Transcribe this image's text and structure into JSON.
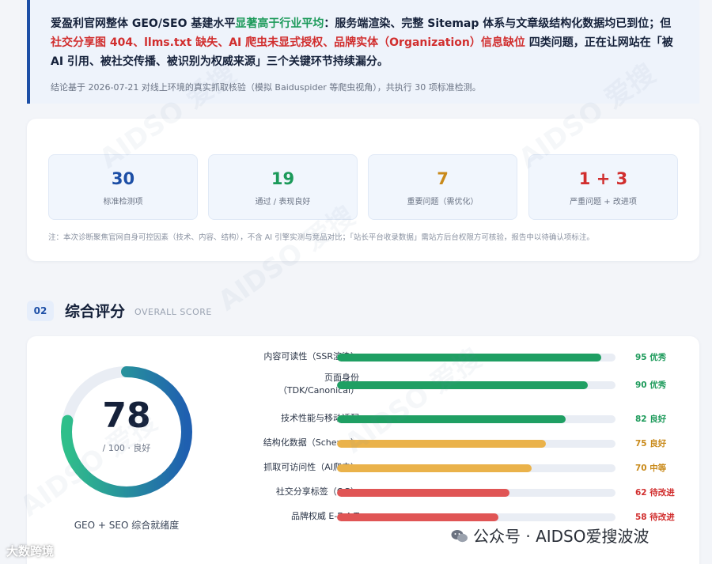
{
  "summary": {
    "part1": "爱盈利官网整体 GEO/SEO 基建水平",
    "highlight_green": "显著高于行业平均",
    "part2": "：服务端渲染、完整 Sitemap 体系与文章级结构化数据均已到位；但 ",
    "highlight_red": "社交分享图 404、llms.txt 缺失、AI 爬虫未显式授权、品牌实体（Organization）信息缺位",
    "part3": " 四类问题，正在让网站在「被 AI 引用、被社交传播、被识别为权威来源」三个关键环节持续漏分。",
    "note": "结论基于 2026-07-21 对线上环境的真实抓取核验（模拟 Baiduspider 等爬虫视角），共执行 30 项标准检测。"
  },
  "stats": [
    {
      "value": "30",
      "label": "标准检测项",
      "color": "#1d4fa6"
    },
    {
      "value": "19",
      "label": "通过 / 表现良好",
      "color": "#1c9a5a"
    },
    {
      "value": "7",
      "label": "重要问题（需优化）",
      "color": "#c98a1a"
    },
    {
      "value": "1 + 3",
      "label": "严重问题 + 改进项",
      "color": "#d12e2e"
    }
  ],
  "stats_note": "注：本次诊断聚焦官网自身可控因素（技术、内容、结构），不含 AI 引擎实测与竞品对比；「站长平台收录数据」需站方后台权限方可核验，报告中以待确认项标注。",
  "section": {
    "number": "02",
    "title": "综合评分",
    "subtitle": "OVERALL SCORE"
  },
  "gauge": {
    "value": "78",
    "sub": "/ 100 · 良好",
    "caption": "GEO + SEO 综合就绪度",
    "fraction": 0.78
  },
  "bars": [
    {
      "label": "内容可读性（SSR渲染）",
      "value": 95,
      "score_text": "95 优秀",
      "color": "#1f9f63",
      "text_color": "#1c9a5a"
    },
    {
      "label": "页面身份\n（TDK/Canonical）",
      "value": 90,
      "score_text": "90 优秀",
      "color": "#1f9f63",
      "text_color": "#1c9a5a"
    },
    {
      "label": "技术性能与移动适配",
      "value": 82,
      "score_text": "82 良好",
      "color": "#1f9f63",
      "text_color": "#1c9a5a"
    },
    {
      "label": "结构化数据（Schema）",
      "value": 75,
      "score_text": "75 良好",
      "color": "#eab24a",
      "text_color": "#c98a1a"
    },
    {
      "label": "抓取可访问性（AI爬虫）",
      "value": 70,
      "score_text": "70 中等",
      "color": "#eab24a",
      "text_color": "#c98a1a"
    },
    {
      "label": "社交分享标签（OG）",
      "value": 62,
      "score_text": "62 待改进",
      "color": "#e05555",
      "text_color": "#d12e2e"
    },
    {
      "label": "品牌权威 E-E-A-T",
      "value": 58,
      "score_text": "58 待改进",
      "color": "#e05555",
      "text_color": "#d12e2e"
    }
  ],
  "footer": {
    "left": "大数跨境",
    "right": "公众号 · AIDSO爱搜波波"
  },
  "watermark": "AIDSO 爱搜"
}
